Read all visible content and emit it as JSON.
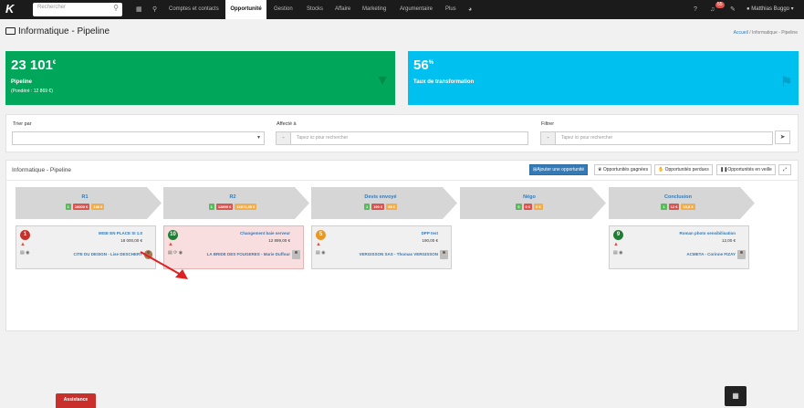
{
  "app": {
    "logo": "K"
  },
  "search": {
    "placeholder": "Rechercher"
  },
  "nav": {
    "items": [
      "Comptes et contacts",
      "Opportunité",
      "Gestion",
      "Stocks",
      "Affaire",
      "Marketing",
      "Argumentaire",
      "Plus"
    ],
    "active": "Opportunité",
    "notif_count": "55",
    "user": "Matthias Buggo"
  },
  "page": {
    "title": "Informatique - Pipeline"
  },
  "breadcrumb": {
    "home": "Accueil",
    "sep": "/",
    "current": "Informatique - Pipeline"
  },
  "kpis": [
    {
      "value": "23 101",
      "unit": "€",
      "label": "Pipeline",
      "sub": "(Pondéré : 12 869 €)",
      "color": "#00a65a"
    },
    {
      "value": "56",
      "unit": "%",
      "label": "Taux de transformation",
      "sub": "",
      "color": "#00c0ef"
    }
  ],
  "filters": {
    "sort_label": "Trier par",
    "sort_value": "",
    "assigned_label": "Affecté à",
    "assigned_placeholder": "Tapez ici pour rechercher",
    "filter_label": "Filtrer",
    "filter_placeholder": "Tapez ici pour rechercher"
  },
  "board": {
    "title": "Informatique - Pipeline",
    "buttons": {
      "add": "Ajouter une opportunité",
      "won": "Opportunités gagnées",
      "lost": "Opportunités perdues",
      "standby": "Opportunités en veille"
    }
  },
  "stages": [
    {
      "name": "R1",
      "badges": [
        {
          "t": "1",
          "c": "g"
        },
        {
          "t": "18000 €",
          "c": "r"
        },
        {
          "t": "180 €",
          "c": "o"
        }
      ]
    },
    {
      "name": "R2",
      "badges": [
        {
          "t": "1",
          "c": "g"
        },
        {
          "t": "12899 €",
          "c": "r"
        },
        {
          "t": "12674,35 €",
          "c": "o"
        }
      ]
    },
    {
      "name": "Devis envoyé",
      "badges": [
        {
          "t": "1",
          "c": "g"
        },
        {
          "t": "190 €",
          "c": "r"
        },
        {
          "t": "95 €",
          "c": "o"
        }
      ]
    },
    {
      "name": "Négo",
      "badges": [
        {
          "t": "0",
          "c": "g"
        },
        {
          "t": "0 €",
          "c": "r"
        },
        {
          "t": "0 €",
          "c": "o"
        }
      ]
    },
    {
      "name": "Conclusion",
      "badges": [
        {
          "t": "1",
          "c": "g"
        },
        {
          "t": "12 €",
          "c": "r"
        },
        {
          "t": "10,8 €",
          "c": "o"
        }
      ]
    }
  ],
  "cards": [
    {
      "count": "1",
      "count_color": "#c9302c",
      "title": "MISE EN PLACE SI 1.0",
      "amount": "18 000,00 €",
      "company": "CITE DU DESIGN - Lise DESCHERT",
      "tools": "▤ ◉",
      "pink": false
    },
    {
      "count": "10",
      "count_color": "#1e7e34",
      "title": "Changement baie serveur",
      "amount": "12 899,00 €",
      "company": "LA BRIDE DES FOUGERES - Marie Duffour",
      "tools": "▤ ⟳ ◉",
      "pink": true
    },
    {
      "count": "5",
      "count_color": "#ec971f",
      "title": "DPP test",
      "amount": "190,00 €",
      "company": "VERGISSON SAS - Thomas VERGISSON",
      "tools": "▤ ◉",
      "pink": false
    },
    {
      "count": "9",
      "count_color": "#1e7e34",
      "title": "Roman photo sensibilisation",
      "amount": "12,00 €",
      "company": "ACMETA - Corinne FIZAY",
      "tools": "▤ ◉",
      "pink": false
    }
  ],
  "footer": {
    "assist": "Assistance"
  }
}
